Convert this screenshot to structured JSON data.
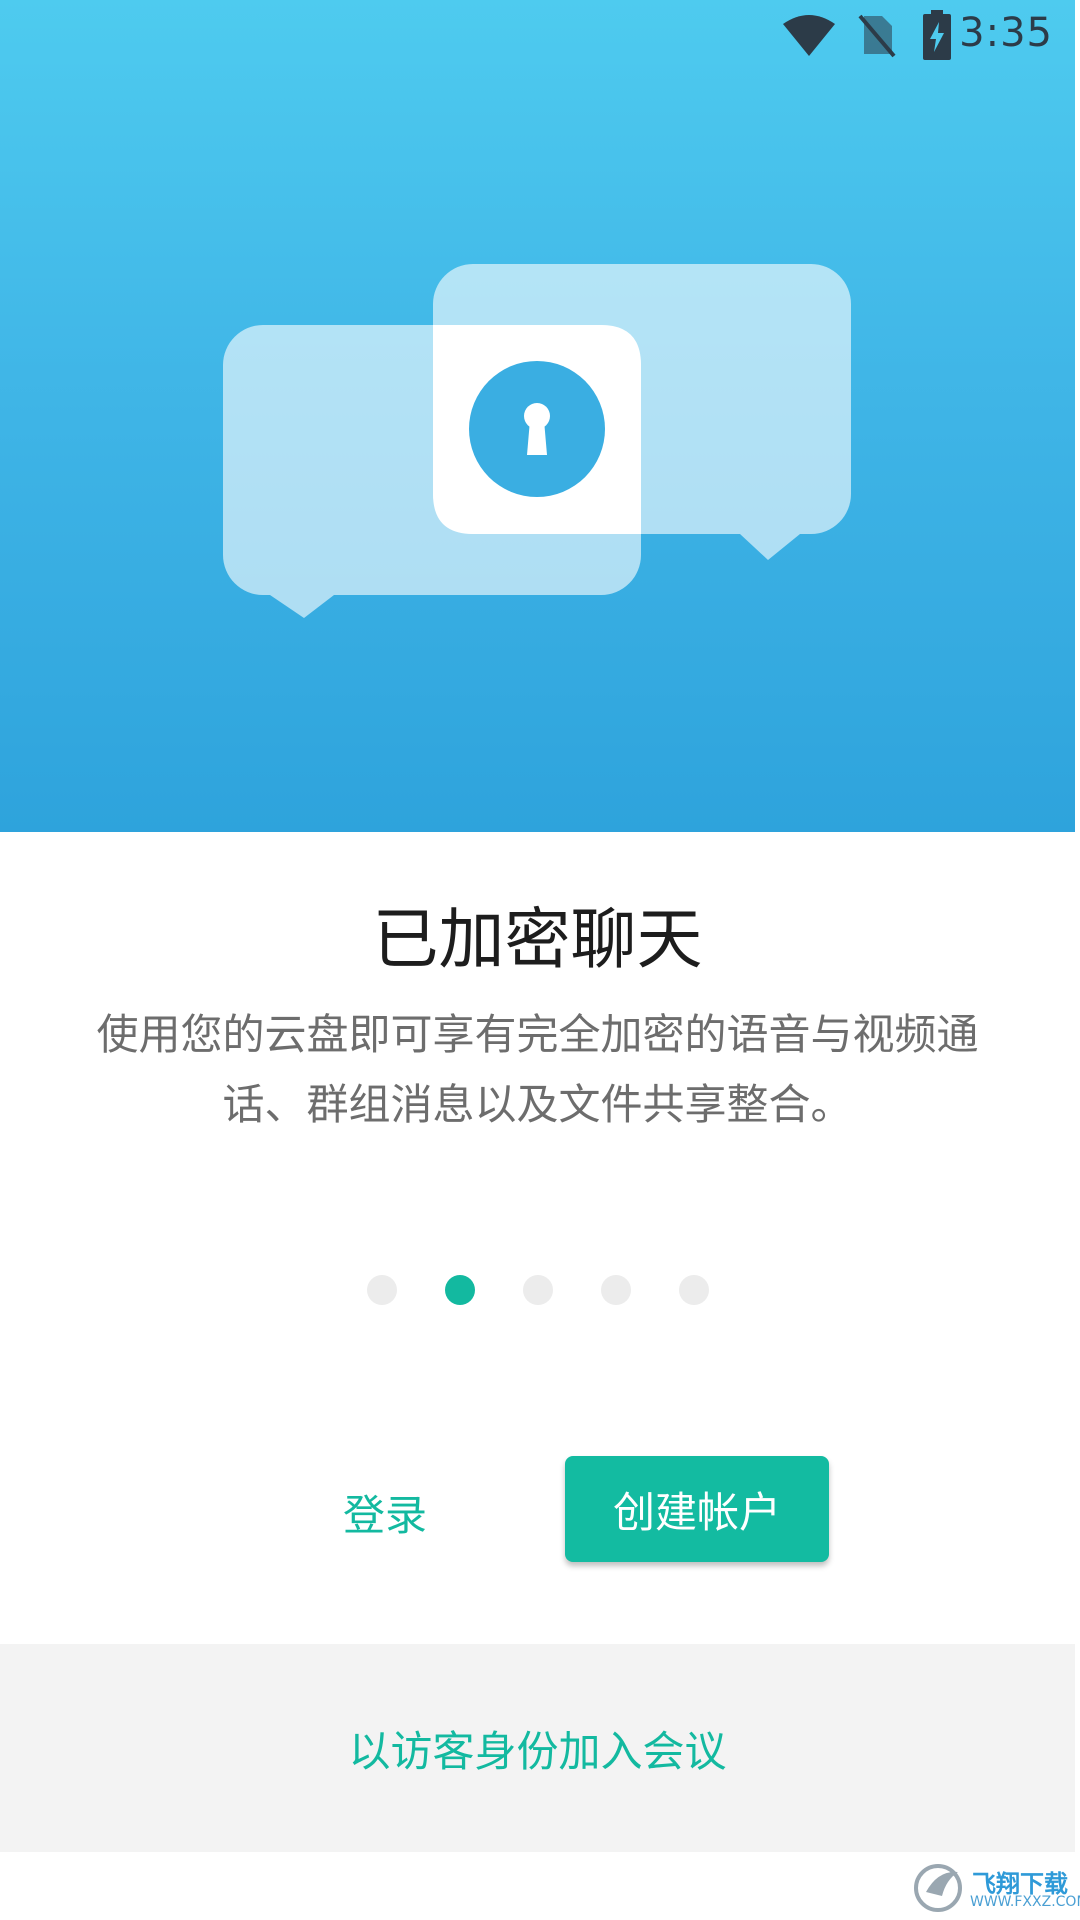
{
  "status_bar": {
    "time": "3:35",
    "icons": [
      "wifi-icon",
      "no-sim-icon",
      "battery-charging-icon"
    ]
  },
  "illustration": {
    "icon": "keyhole-lock-icon"
  },
  "content": {
    "title": "已加密聊天",
    "description": "使用您的云盘即可享有完全加密的语音与视频通话、群组消息以及文件共享整合。"
  },
  "pager": {
    "total": 5,
    "active_index": 1
  },
  "actions": {
    "login_label": "登录",
    "create_account_label": "创建帐户",
    "guest_join_label": "以访客身份加入会议"
  },
  "watermark": {
    "text": "飞翔下载",
    "url": "WWW.FXXZ.COM"
  },
  "colors": {
    "accent": "#13b9a0",
    "hero_top": "#4ecbef",
    "hero_bottom": "#2ea3dc"
  }
}
